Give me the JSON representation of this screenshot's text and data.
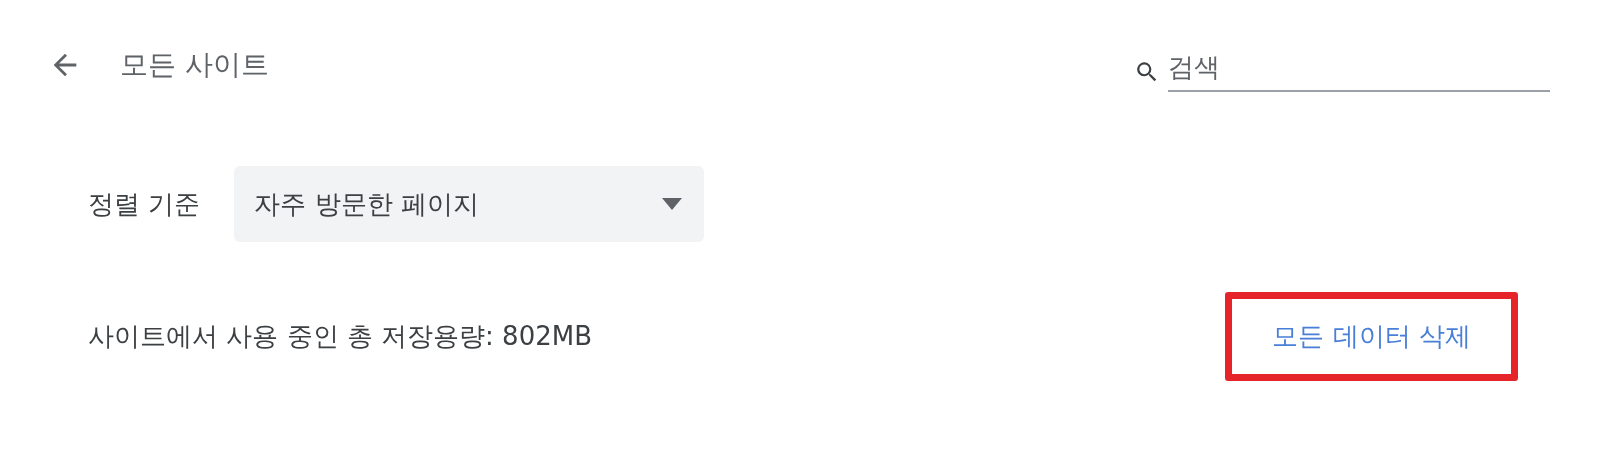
{
  "header": {
    "title": "모든 사이트",
    "search": {
      "placeholder": "검색"
    }
  },
  "sort": {
    "label": "정렬 기준",
    "value": "자주 방문한 페이지"
  },
  "storage": {
    "text": "사이트에서 사용 중인 총 저장용량: 802MB",
    "button": {
      "label": "모든 데이터 삭제",
      "highlighted": true
    }
  }
}
